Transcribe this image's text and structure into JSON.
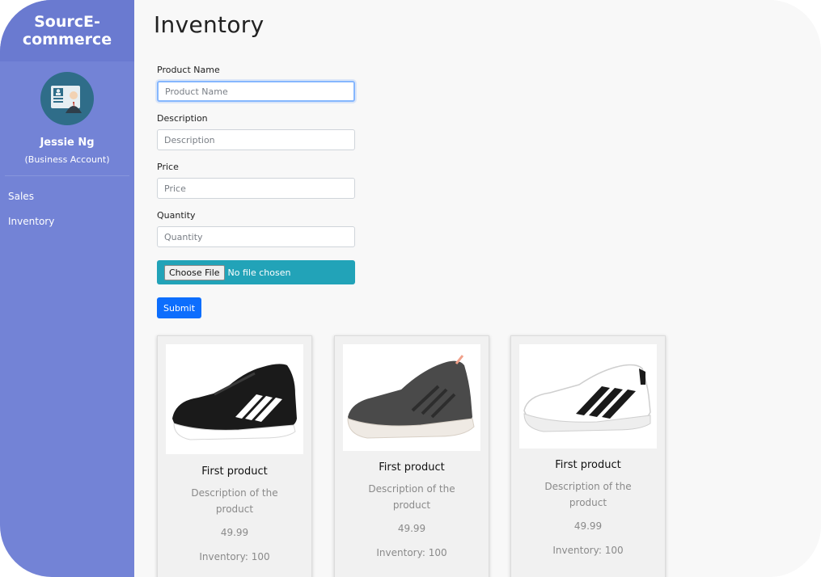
{
  "sidebar": {
    "brand": "SourcE-commerce",
    "avatar_icon": "business-user-icon",
    "user_name": "Jessie Ng",
    "account_type": "(Business Account)",
    "nav": [
      "Sales",
      "Inventory"
    ],
    "colors": {
      "background": "#7383d6",
      "brand_background": "#6a7ad0"
    }
  },
  "main": {
    "title": "Inventory",
    "form": {
      "product_name": {
        "label": "Product Name",
        "placeholder": "Product Name"
      },
      "description": {
        "label": "Description",
        "placeholder": "Description"
      },
      "price": {
        "label": "Price",
        "placeholder": "Price"
      },
      "quantity": {
        "label": "Quantity",
        "placeholder": "Quantity"
      },
      "file": {
        "button": "Choose File",
        "status": "No file chosen"
      },
      "submit": "Submit"
    },
    "products": [
      {
        "title": "First product",
        "description": "Description of the product",
        "price": "49.99",
        "inventory": "Inventory: 100",
        "image": "black-sneaker-white-stripes"
      },
      {
        "title": "First product",
        "description": "Description of the product",
        "price": "49.99",
        "inventory": "Inventory: 100",
        "image": "grey-running-shoe"
      },
      {
        "title": "First product",
        "description": "Description of the product",
        "price": "49.99",
        "inventory": "Inventory: 100",
        "image": "white-sneaker-black-stripes"
      }
    ]
  }
}
